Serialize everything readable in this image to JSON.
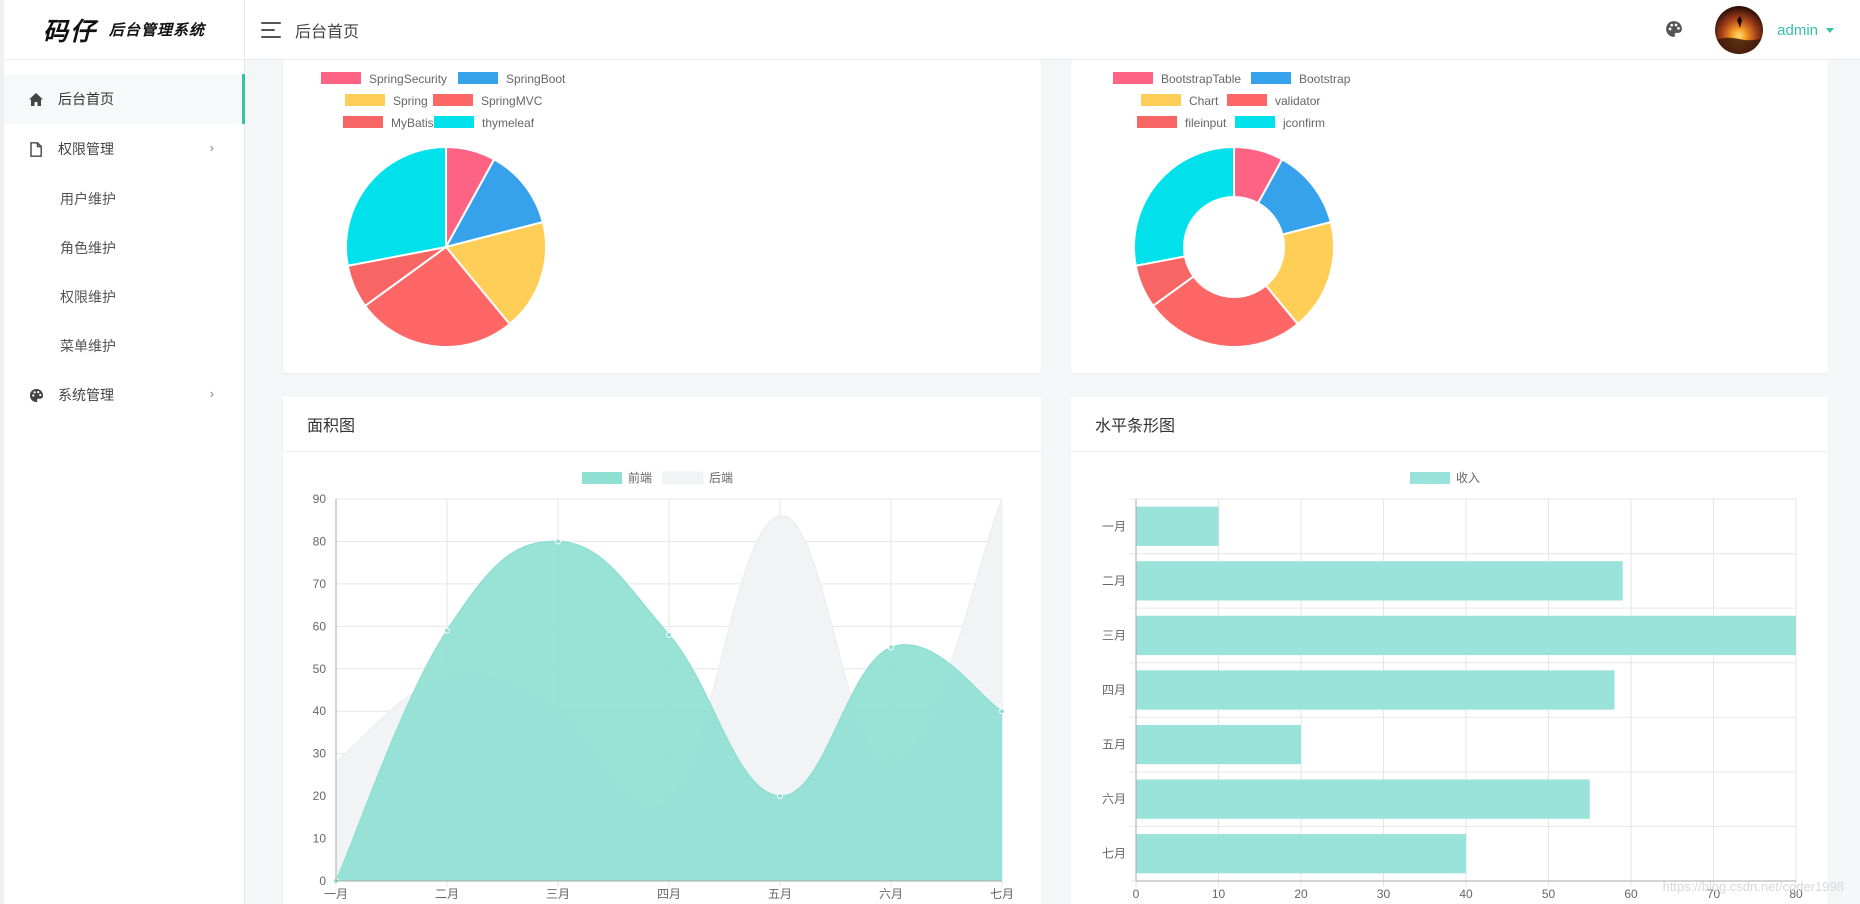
{
  "sidebar": {
    "logo_main": "码仔",
    "logo_sub": "后台管理系统",
    "items": [
      {
        "label": "后台首页",
        "icon": "home-icon"
      },
      {
        "label": "权限管理",
        "icon": "file-icon"
      },
      {
        "label": "用户维护"
      },
      {
        "label": "角色维护"
      },
      {
        "label": "权限维护"
      },
      {
        "label": "菜单维护"
      },
      {
        "label": "系统管理",
        "icon": "palette-icon"
      }
    ]
  },
  "header": {
    "title": "后台首页",
    "user": "admin"
  },
  "cards": {
    "area_title": "面积图",
    "bar_title": "水平条形图"
  },
  "watermark": "https://blog.csdn.net/coder1998",
  "colors": {
    "accent": "#38c0a8",
    "teal_fill": "#8fdfd3",
    "gray_fill": "#f2f3f5"
  },
  "chart_data": [
    {
      "type": "pie",
      "labels": [
        "SpringSecurity",
        "SpringBoot",
        "Spring",
        "SpringMVC",
        "MyBatis",
        "thymeleaf"
      ],
      "values": [
        8,
        13,
        18,
        26,
        7,
        28
      ],
      "colors": [
        "#ff6384",
        "#36a2eb",
        "#ffce56",
        "#ff6666",
        "#f76565",
        "#00e1ec"
      ]
    },
    {
      "type": "pie",
      "variant": "doughnut",
      "labels": [
        "BootstrapTable",
        "Bootstrap",
        "Chart",
        "validator",
        "fileinput",
        "jconfirm"
      ],
      "values": [
        8,
        13,
        18,
        26,
        7,
        28
      ],
      "colors": [
        "#ff6384",
        "#36a2eb",
        "#ffce56",
        "#ff6666",
        "#f76565",
        "#00e1ec"
      ]
    },
    {
      "type": "area",
      "categories": [
        "一月",
        "二月",
        "三月",
        "四月",
        "五月",
        "六月",
        "七月"
      ],
      "series": [
        {
          "name": "前端",
          "values": [
            0,
            59,
            80,
            58,
            20,
            55,
            40
          ],
          "color": "#8fdfd3"
        },
        {
          "name": "后端",
          "values": [
            28,
            48,
            40,
            19,
            86,
            27,
            90
          ],
          "color": "#f2f3f5"
        }
      ],
      "ylim": [
        0,
        90
      ],
      "yticks": [
        0,
        10,
        20,
        30,
        40,
        50,
        60,
        70,
        80,
        90
      ],
      "grid": true,
      "legend": "top-center"
    },
    {
      "type": "bar",
      "orientation": "horizontal",
      "categories": [
        "一月",
        "二月",
        "三月",
        "四月",
        "五月",
        "六月",
        "七月"
      ],
      "series": [
        {
          "name": "收入",
          "values": [
            10,
            59,
            80,
            58,
            20,
            55,
            40
          ],
          "color": "#99e3da"
        }
      ],
      "xlim": [
        0,
        80
      ],
      "xticks": [
        0,
        10,
        20,
        30,
        40,
        50,
        60,
        70,
        80
      ],
      "grid": true,
      "legend": "top-center"
    }
  ]
}
